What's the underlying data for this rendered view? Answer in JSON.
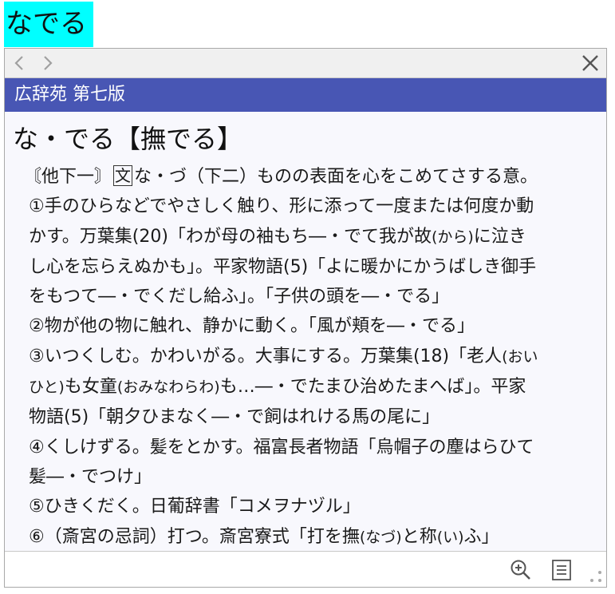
{
  "query": {
    "text": "なでる",
    "highlight_color": "#00ffff"
  },
  "toolbar": {
    "back_icon": "chevron-left-icon",
    "forward_icon": "chevron-right-icon",
    "close_icon": "close-icon"
  },
  "dictionary": {
    "name": "広辞苑 第七版",
    "bar_color": "#4856b4"
  },
  "entry": {
    "headword": "な・でる【撫でる】",
    "line1_a": "〘他下一〙",
    "line1_mark": "文",
    "line1_b": "な・づ（下二）ものの表面を心をこめてさする意。",
    "l2": "①手のひらなどでやさしく触り、形に添って一度または何度か動",
    "l3_a": "かす。万葉集(20)「わが母の袖もち―・でて我が故",
    "l3_r": "(から)",
    "l3_b": "に泣き",
    "l4": "し心を忘らえぬかも」。平家物語(5)「よに暖かにかうばしき御手",
    "l5": "をもつて―・でくだし給ふ」。「子供の頭を―・でる」",
    "l6": "②物が他の物に触れ、静かに動く。「風が頬を―・でる」",
    "l7_a": "③いつくしむ。かわいがる。大事にする。万葉集(18)「老人",
    "l7_r": "(おい",
    "l8_r": "ひと)",
    "l8_a": "も女童",
    "l8_r2": "(おみなわらわ)",
    "l8_b": "も…―・でたまひ治めたまへば」。平家",
    "l9": "物語(5)「朝夕ひまなく―・で飼はれける馬の尾に」",
    "l10": "④くしけずる。髪をとかす。福富長者物語「烏帽子の塵はらひて",
    "l11": "髪―・でつけ」",
    "l12": "⑤ひきくだく。日葡辞書「コメヲナヅル」",
    "l13_a": "⑥（斎宮の忌詞）打つ。斎宮寮式「打を撫",
    "l13_r": "(なづ)",
    "l13_b": "と称",
    "l13_r2": "(い)",
    "l13_c": "ふ」"
  },
  "footer": {
    "zoom_icon": "zoom-in-icon",
    "menu_icon": "list-icon",
    "resize_icon": "resize-grip-icon"
  }
}
